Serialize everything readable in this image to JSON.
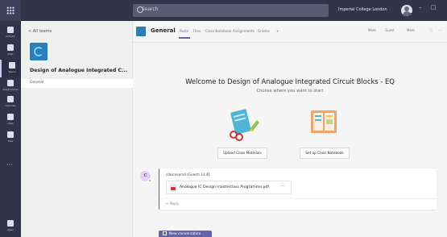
{
  "search": {
    "placeholder": "Search"
  },
  "user": {
    "org": "Imperial College London"
  },
  "window_controls": [
    "–",
    "□"
  ],
  "rail": [
    {
      "icon": "bell-icon",
      "label": "Activity"
    },
    {
      "icon": "chat-icon",
      "label": "Chat"
    },
    {
      "icon": "teams-icon",
      "label": "Teams"
    },
    {
      "icon": "assignments-icon",
      "label": "Assignments"
    },
    {
      "icon": "calendar-icon",
      "label": "Calendar"
    },
    {
      "icon": "calls-icon",
      "label": "Calls"
    },
    {
      "icon": "files-icon",
      "label": "Files"
    }
  ],
  "rail_more": "···",
  "rail_apps": {
    "icon": "apps-icon",
    "label": "Apps"
  },
  "panel": {
    "back_label": "< All teams",
    "team_name": "Design of Analogue Integrated C...",
    "team_more": "···",
    "channels": [
      "General"
    ]
  },
  "header": {
    "channel": "General",
    "tabs": [
      "Posts",
      "Files",
      "Class Notebook",
      "Assignments",
      "Grades",
      "+"
    ],
    "active_tab": "Posts",
    "buttons": [
      "Meet",
      "Guest",
      "Meet",
      "ⓘ",
      "···"
    ]
  },
  "welcome": {
    "title": "Welcome to Design of Analogue Integrated Circuit Blocks - EQ",
    "subtitle": "Choose where you want to start",
    "actions": [
      {
        "label": "Upload Class Materials",
        "icon": "upload-materials-illustration"
      },
      {
        "label": "Set up Class Notebook",
        "icon": "class-notebook-illustration"
      }
    ]
  },
  "post": {
    "avatar_initial": "C",
    "author": "cdiscoverall (Guest)   13:41",
    "file_name": "Analogue IC Design masterclass Programme.pdf",
    "file_more": "···",
    "reply_label": "↩ Reply"
  },
  "new_conversation": "New conversation",
  "colors": {
    "accent": "#6264a7",
    "rail": "#33344a",
    "presence": "#92c353"
  }
}
